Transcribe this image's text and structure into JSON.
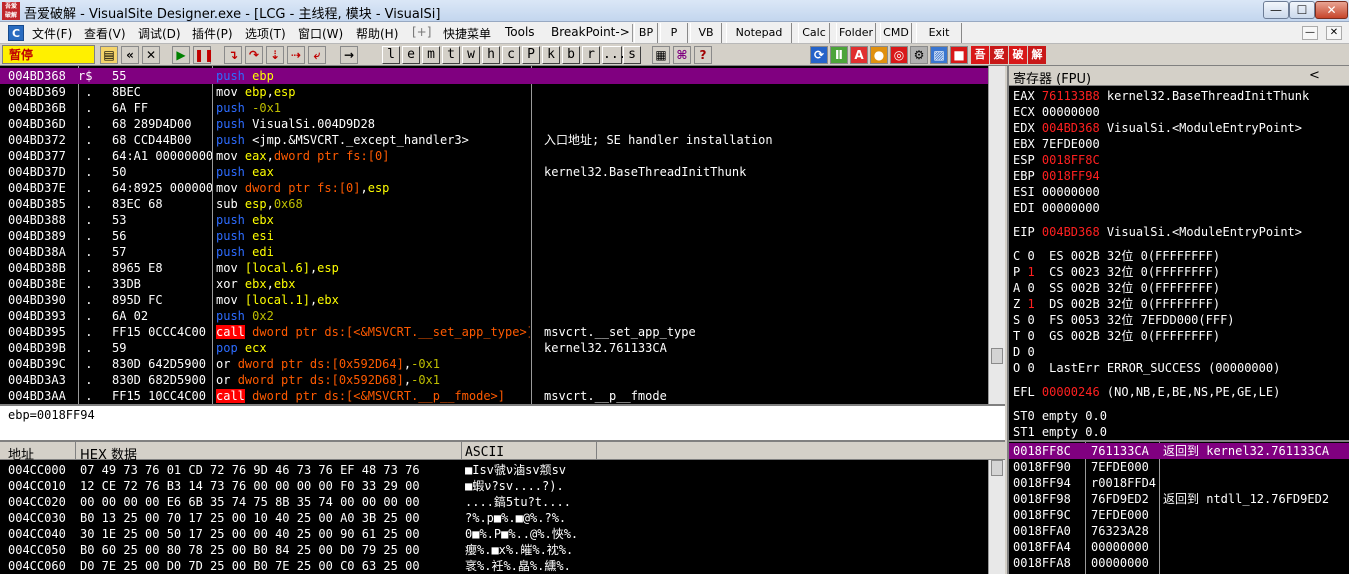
{
  "window": {
    "title": "吾爱破解 - VisualSite Designer.exe - [LCG - 主线程, 模块 - VisualSi]",
    "logo_text": "吾爱破解"
  },
  "window_controls": {
    "minimize": "—",
    "maximize": "☐",
    "close": "✕"
  },
  "menu": {
    "items": [
      "文件(F)",
      "查看(V)",
      "调试(D)",
      "插件(P)",
      "选项(T)",
      "窗口(W)",
      "帮助(H)",
      "[+]",
      "快捷菜单",
      "Tools",
      "BreakPoint->"
    ],
    "plugin_buttons": [
      "BP",
      "P",
      "VB",
      "Notepad",
      "Calc",
      "Folder",
      "CMD",
      "Exit"
    ],
    "mdi_min": "—",
    "mdi_close": "✕"
  },
  "toolbar": {
    "status": "暂停",
    "letter_buttons": [
      "l",
      "e",
      "m",
      "t",
      "w",
      "h",
      "c",
      "P",
      "k",
      "b",
      "r",
      "...",
      "s"
    ],
    "color_buttons": [
      "吾",
      "爱",
      "破",
      "解"
    ]
  },
  "disasm": {
    "rows": [
      {
        "addr": "004BD368",
        "mark": "r$",
        "hex": "55",
        "asm": [
          [
            "op-push",
            "push"
          ],
          [
            "arg-reg",
            " ebp"
          ]
        ],
        "comment": "",
        "selected": true
      },
      {
        "addr": "004BD369",
        "mark": " .",
        "hex": "8BEC",
        "asm": [
          [
            "",
            "mov "
          ],
          [
            "arg-reg",
            "ebp"
          ],
          [
            "",
            ","
          ],
          [
            "arg-reg",
            "esp"
          ]
        ],
        "comment": ""
      },
      {
        "addr": "004BD36B",
        "mark": " .",
        "hex": "6A FF",
        "asm": [
          [
            "op-push",
            "push"
          ],
          [
            "arg-imm",
            " -0x1"
          ]
        ],
        "comment": ""
      },
      {
        "addr": "004BD36D",
        "mark": " .",
        "hex": "68 289D4D00",
        "asm": [
          [
            "op-push",
            "push"
          ],
          [
            "",
            " VisualSi.004D9D28"
          ]
        ],
        "comment": ""
      },
      {
        "addr": "004BD372",
        "mark": " .",
        "hex": "68 CCD44B00",
        "asm": [
          [
            "op-push",
            "push"
          ],
          [
            "",
            " <jmp.&MSVCRT._except_handler3>"
          ]
        ],
        "comment": "入口地址; SE handler installation"
      },
      {
        "addr": "004BD377",
        "mark": " .",
        "hex": "64:A1 00000000",
        "asm": [
          [
            "",
            "mov "
          ],
          [
            "arg-reg",
            "eax"
          ],
          [
            "",
            ","
          ],
          [
            "arg-mem",
            "dword ptr fs:[0]"
          ]
        ],
        "comment": ""
      },
      {
        "addr": "004BD37D",
        "mark": " .",
        "hex": "50",
        "asm": [
          [
            "op-push",
            "push"
          ],
          [
            "arg-reg",
            " eax"
          ]
        ],
        "comment": "kernel32.BaseThreadInitThunk"
      },
      {
        "addr": "004BD37E",
        "mark": " .",
        "hex": "64:8925 00000000",
        "asm": [
          [
            "",
            "mov "
          ],
          [
            "arg-mem",
            "dword ptr fs:[0]"
          ],
          [
            "",
            ","
          ],
          [
            "arg-reg",
            "esp"
          ]
        ],
        "comment": ""
      },
      {
        "addr": "004BD385",
        "mark": " .",
        "hex": "83EC 68",
        "asm": [
          [
            "",
            "sub "
          ],
          [
            "arg-reg",
            "esp"
          ],
          [
            "",
            ","
          ],
          [
            "arg-imm",
            "0x68"
          ]
        ],
        "comment": ""
      },
      {
        "addr": "004BD388",
        "mark": " .",
        "hex": "53",
        "asm": [
          [
            "op-push",
            "push"
          ],
          [
            "arg-reg",
            " ebx"
          ]
        ],
        "comment": ""
      },
      {
        "addr": "004BD389",
        "mark": " .",
        "hex": "56",
        "asm": [
          [
            "op-push",
            "push"
          ],
          [
            "arg-reg",
            " esi"
          ]
        ],
        "comment": ""
      },
      {
        "addr": "004BD38A",
        "mark": " .",
        "hex": "57",
        "asm": [
          [
            "op-push",
            "push"
          ],
          [
            "arg-reg",
            " edi"
          ]
        ],
        "comment": ""
      },
      {
        "addr": "004BD38B",
        "mark": " .",
        "hex": "8965 E8",
        "asm": [
          [
            "",
            "mov "
          ],
          [
            "arg-reg",
            "[local.6]"
          ],
          [
            "",
            ","
          ],
          [
            "arg-reg",
            "esp"
          ]
        ],
        "comment": ""
      },
      {
        "addr": "004BD38E",
        "mark": " .",
        "hex": "33DB",
        "asm": [
          [
            "",
            "xor "
          ],
          [
            "arg-reg",
            "ebx"
          ],
          [
            "",
            ","
          ],
          [
            "arg-reg",
            "ebx"
          ]
        ],
        "comment": ""
      },
      {
        "addr": "004BD390",
        "mark": " .",
        "hex": "895D FC",
        "asm": [
          [
            "",
            "mov "
          ],
          [
            "arg-reg",
            "[local.1]"
          ],
          [
            "",
            ","
          ],
          [
            "arg-reg",
            "ebx"
          ]
        ],
        "comment": ""
      },
      {
        "addr": "004BD393",
        "mark": " .",
        "hex": "6A 02",
        "asm": [
          [
            "op-push",
            "push"
          ],
          [
            "arg-imm",
            " 0x2"
          ]
        ],
        "comment": ""
      },
      {
        "addr": "004BD395",
        "mark": " .",
        "hex": "FF15 0CCC4C00",
        "asm": [
          [
            "op-call",
            "call"
          ],
          [
            "arg-mem",
            " dword ptr ds:[<&MSVCRT.__set_app_type>]"
          ]
        ],
        "comment": "msvcrt.__set_app_type"
      },
      {
        "addr": "004BD39B",
        "mark": " .",
        "hex": "59",
        "asm": [
          [
            "op-push",
            "pop"
          ],
          [
            "arg-reg",
            " ecx"
          ]
        ],
        "comment": "kernel32.761133CA"
      },
      {
        "addr": "004BD39C",
        "mark": " .",
        "hex": "830D 642D5900 FF",
        "asm": [
          [
            "",
            "or "
          ],
          [
            "arg-mem",
            "dword ptr ds:[0x592D64]"
          ],
          [
            "",
            ","
          ],
          [
            "arg-imm",
            "-0x1"
          ]
        ],
        "comment": ""
      },
      {
        "addr": "004BD3A3",
        "mark": " .",
        "hex": "830D 682D5900 FF",
        "asm": [
          [
            "",
            "or "
          ],
          [
            "arg-mem",
            "dword ptr ds:[0x592D68]"
          ],
          [
            "",
            ","
          ],
          [
            "arg-imm",
            "-0x1"
          ]
        ],
        "comment": ""
      },
      {
        "addr": "004BD3AA",
        "mark": " .",
        "hex": "FF15 10CC4C00",
        "asm": [
          [
            "op-call",
            "call"
          ],
          [
            "arg-mem",
            " dword ptr ds:[<&MSVCRT.__p__fmode>]"
          ]
        ],
        "comment": "msvcrt.__p__fmode"
      }
    ]
  },
  "info": {
    "text": "ebp=0018FF94"
  },
  "dump": {
    "headers": {
      "address": "地址",
      "hex": "HEX 数据",
      "ascii": "ASCII"
    },
    "rows": [
      {
        "addr": "004CC000",
        "hex": "07 49 73 76 01 CD 72 76 9D 46 73 76 EF 48 73 76",
        "ascii": "■Isv虢ν滷sv颒sv"
      },
      {
        "addr": "004CC010",
        "hex": "12 CE 72 76 B3 14 73 76 00 00 00 00 F0 33 29 00",
        "ascii": "■蝦ν?sv....?)."
      },
      {
        "addr": "004CC020",
        "hex": "00 00 00 00 E6 6B 35 74 75 8B 35 74 00 00 00 00",
        "ascii": "....鎬5tu?t...."
      },
      {
        "addr": "004CC030",
        "hex": "B0 13 25 00 70 17 25 00 10 40 25 00 A0 3B 25 00",
        "ascii": "?%.p■%.■@%.?%."
      },
      {
        "addr": "004CC040",
        "hex": "30 1E 25 00 50 17 25 00 00 40 25 00 90 61 25 00",
        "ascii": "0■%.P■%..@%.悏%."
      },
      {
        "addr": "004CC050",
        "hex": "B0 60 25 00 80 78 25 00 B0 84 25 00 D0 79 25 00",
        "ascii": "癭%.■x%.皠%.衴%."
      },
      {
        "addr": "004CC060",
        "hex": "D0 7E 25 00 D0 7D 25 00 B0 7E 25 00 C0 63 25 00",
        "ascii": "衺%.衽%.皛%.纁%."
      }
    ]
  },
  "registers": {
    "title": "寄存器 (FPU)",
    "arrow": "<",
    "general": [
      {
        "name": "EAX",
        "value": "761133B8",
        "red": true,
        "note": "kernel32.BaseThreadInitThunk"
      },
      {
        "name": "ECX",
        "value": "00000000",
        "red": false,
        "note": ""
      },
      {
        "name": "EDX",
        "value": "004BD368",
        "red": true,
        "note": "VisualSi.<ModuleEntryPoint>"
      },
      {
        "name": "EBX",
        "value": "7EFDE000",
        "red": false,
        "note": ""
      },
      {
        "name": "ESP",
        "value": "0018FF8C",
        "red": true,
        "note": ""
      },
      {
        "name": "EBP",
        "value": "0018FF94",
        "red": true,
        "note": ""
      },
      {
        "name": "ESI",
        "value": "00000000",
        "red": false,
        "note": ""
      },
      {
        "name": "EDI",
        "value": "00000000",
        "red": false,
        "note": ""
      }
    ],
    "eip": {
      "name": "EIP",
      "value": "004BD368",
      "note": "VisualSi.<ModuleEntryPoint>"
    },
    "flags": [
      {
        "flag": "C",
        "val": "0",
        "red": false,
        "seg": "ES 002B 32位 0(FFFFFFFF)"
      },
      {
        "flag": "P",
        "val": "1",
        "red": true,
        "seg": "CS 0023 32位 0(FFFFFFFF)"
      },
      {
        "flag": "A",
        "val": "0",
        "red": false,
        "seg": "SS 002B 32位 0(FFFFFFFF)"
      },
      {
        "flag": "Z",
        "val": "1",
        "red": true,
        "seg": "DS 002B 32位 0(FFFFFFFF)"
      },
      {
        "flag": "S",
        "val": "0",
        "red": false,
        "seg": "FS 0053 32位 7EFDD000(FFF)"
      },
      {
        "flag": "T",
        "val": "0",
        "red": false,
        "seg": "GS 002B 32位 0(FFFFFFFF)"
      },
      {
        "flag": "D",
        "val": "0",
        "red": false,
        "seg": ""
      },
      {
        "flag": "O",
        "val": "0",
        "red": false,
        "seg": "LastErr ERROR_SUCCESS (00000000)"
      }
    ],
    "efl": {
      "name": "EFL",
      "value": "00000246",
      "note": "(NO,NB,E,BE,NS,PE,GE,LE)"
    },
    "fpu": [
      "ST0 empty 0.0",
      "ST1 empty 0.0"
    ]
  },
  "stack": {
    "rows": [
      {
        "addr": "0018FF8C",
        "val": "761133CA",
        "cmt": "返回到 kernel32.761133CA",
        "selected": true
      },
      {
        "addr": "0018FF90",
        "val": "7EFDE000",
        "cmt": ""
      },
      {
        "addr": "0018FF94",
        "val": "r0018FFD4",
        "cmt": ""
      },
      {
        "addr": "0018FF98",
        "val": "76FD9ED2",
        "cmt": "返回到 ntdll_12.76FD9ED2"
      },
      {
        "addr": "0018FF9C",
        "val": "7EFDE000",
        "cmt": ""
      },
      {
        "addr": "0018FFA0",
        "val": "76323A28",
        "cmt": ""
      },
      {
        "addr": "0018FFA4",
        "val": "00000000",
        "cmt": ""
      },
      {
        "addr": "0018FFA8",
        "val": "00000000",
        "cmt": ""
      }
    ]
  }
}
